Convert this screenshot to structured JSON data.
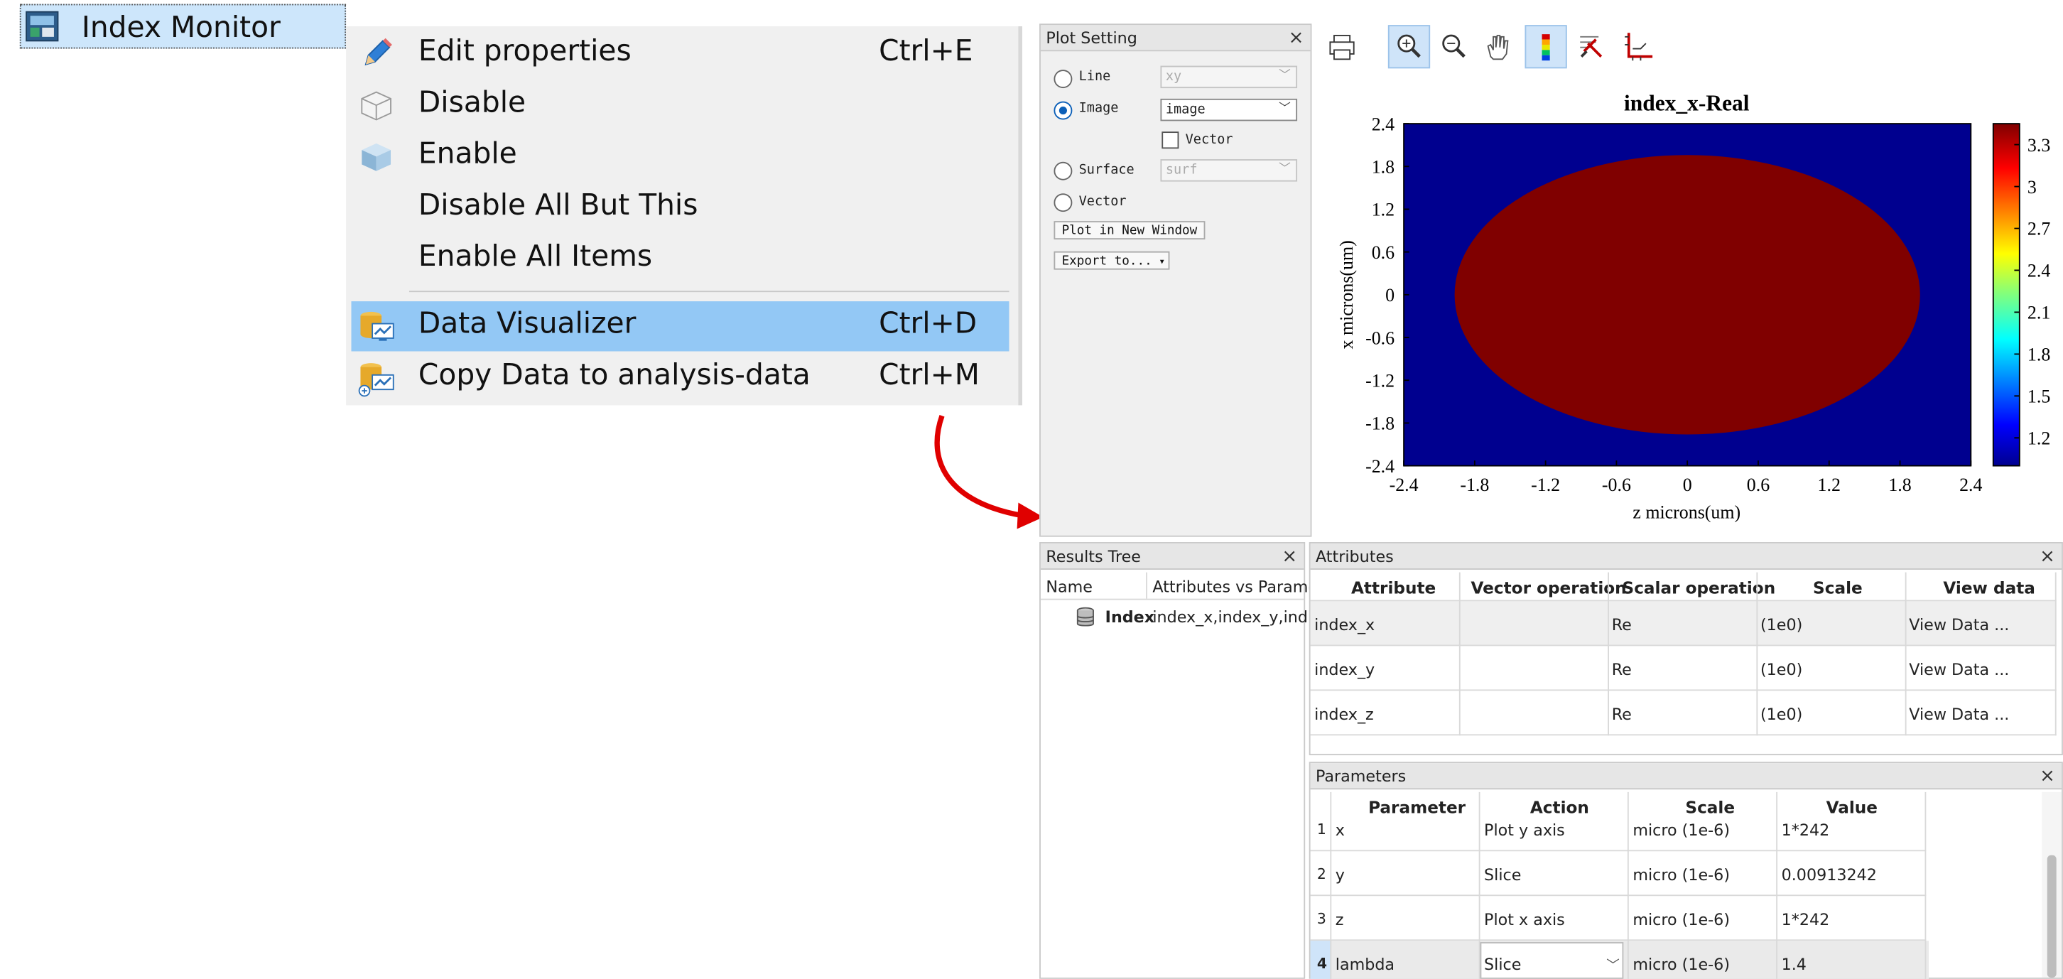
{
  "tree_item": {
    "label": "Index Monitor"
  },
  "context_menu": {
    "items": [
      {
        "label": "Edit properties",
        "shortcut": "Ctrl+E",
        "icon": "pencil-icon"
      },
      {
        "label": "Disable",
        "shortcut": "",
        "icon": "disabled-box-icon"
      },
      {
        "label": "Enable",
        "shortcut": "",
        "icon": "enabled-box-icon"
      },
      {
        "label": "Disable All But This",
        "shortcut": ""
      },
      {
        "label": "Enable All Items",
        "shortcut": ""
      },
      {
        "label": "Data Visualizer",
        "shortcut": "Ctrl+D",
        "icon": "data-visualizer-icon",
        "selected": true
      },
      {
        "label": "Copy Data to analysis-data",
        "shortcut": "Ctrl+M",
        "icon": "copy-data-icon"
      }
    ]
  },
  "plot_setting": {
    "title": "Plot Setting",
    "close": "×",
    "line_label": "Line",
    "line_value": "xy",
    "image_label": "Image",
    "image_value": "image",
    "vector_check_label": "Vector",
    "surface_label": "Surface",
    "surface_value": "surf",
    "vector_label": "Vector",
    "plot_new_window": "Plot in New Window",
    "export_to": "Export to..."
  },
  "toolbar": {
    "icons": [
      "print-icon",
      "zoom-in-icon",
      "zoom-out-icon",
      "pan-hand-icon",
      "colorbar-icon",
      "data-cursor-icon",
      "axes-icon"
    ]
  },
  "chart_data": {
    "type": "heatmap",
    "title": "index_x-Real",
    "xlabel": "z microns(um)",
    "ylabel": "x microns(um)",
    "xlim": [
      -2.4,
      2.4
    ],
    "ylim": [
      -2.4,
      2.4
    ],
    "x_ticks": [
      "-2.4",
      "-1.8",
      "-1.2",
      "-0.6",
      "0",
      "0.6",
      "1.2",
      "1.8",
      "2.4"
    ],
    "y_ticks": [
      "2.4",
      "1.8",
      "1.2",
      "0.6",
      "0",
      "-0.6",
      "-1.2",
      "-1.8",
      "-2.4"
    ],
    "colorbar_ticks": [
      "3.3",
      "3",
      "2.7",
      "2.4",
      "2.1",
      "1.8",
      "1.5",
      "1.2"
    ],
    "colorbar_range": [
      1.0,
      3.45
    ],
    "background_value": 1.0,
    "ellipse_value": 3.45,
    "ellipse": {
      "center_z": 0,
      "center_x": 0,
      "radius_z": 1.97,
      "radius_x": 1.96
    },
    "colormap": "jet",
    "background_color": "#00008f",
    "ellipse_color": "#800000"
  },
  "results_tree": {
    "title": "Results Tree",
    "close": "×",
    "col_name": "Name",
    "col_attrs": "Attributes vs Parame",
    "row_name": "Index",
    "row_attrs": "index_x,index_y,ind..."
  },
  "attributes": {
    "title": "Attributes",
    "close": "×",
    "headers": [
      "Attribute",
      "Vector operation",
      "Scalar operation",
      "Scale",
      "View data"
    ],
    "rows": [
      [
        "index_x",
        "",
        "Re",
        "(1e0)",
        "View Data ..."
      ],
      [
        "index_y",
        "",
        "Re",
        "(1e0)",
        "View Data ..."
      ],
      [
        "index_z",
        "",
        "Re",
        "(1e0)",
        "View Data ..."
      ]
    ]
  },
  "parameters": {
    "title": "Parameters",
    "close": "×",
    "headers": [
      "Parameter",
      "Action",
      "Scale",
      "Value"
    ],
    "rows": [
      [
        "1",
        "x",
        "Plot y axis",
        "micro (1e-6)",
        "1*242"
      ],
      [
        "2",
        "y",
        "Slice",
        "micro (1e-6)",
        "0.00913242"
      ],
      [
        "3",
        "z",
        "Plot x axis",
        "micro (1e-6)",
        "1*242"
      ],
      [
        "4",
        "lambda",
        "Slice",
        "micro (1e-6)",
        "1.4"
      ]
    ]
  },
  "colors": {
    "selection": "#93c8f5",
    "arrow": "#e00000",
    "radio_on": "#0b5fb8"
  }
}
